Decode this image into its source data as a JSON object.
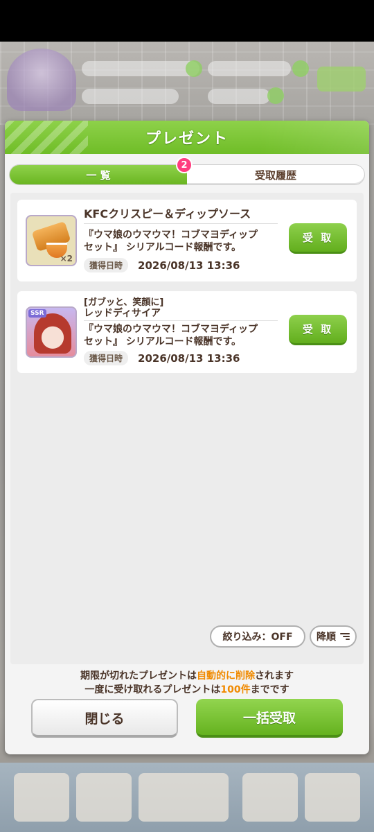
{
  "dialog": {
    "title": "プレゼント"
  },
  "tabs": [
    {
      "label": "一 覧",
      "active": true
    },
    {
      "label": "受取履歴",
      "active": false
    }
  ],
  "badge_count": "2",
  "presents": [
    {
      "title": "KFCクリスピー＆ディップソース",
      "desc1": "『ウマ娘のウマウマ！コブマヨディップ",
      "desc2": "セット』 シリアルコード報酬です。",
      "date_label": "獲得日時",
      "date_value": "2026/08/13 13:36",
      "button": "受 取",
      "qty": "×2",
      "icon": "food-item-icon"
    },
    {
      "title_line1": "[ガブッと、笑顔に]",
      "title_line2": "レッドディサイア",
      "desc1": "『ウマ娘のウマウマ！コブマヨディップ",
      "desc2": "セット』 シリアルコード報酬です。",
      "date_label": "獲得日時",
      "date_value": "2026/08/13 13:36",
      "button": "受 取",
      "rarity": "SSR",
      "icon": "support-card-icon"
    }
  ],
  "filter": {
    "label": "絞り込み：OFF"
  },
  "sort": {
    "label": "降順"
  },
  "notice": {
    "line1_pre": "期限が切れたプレゼントは",
    "line1_hl": "自動的に削除",
    "line1_post": "されます",
    "line2_pre": "一度に受け取れるプレゼントは",
    "line2_hl": "100件",
    "line2_post": "までです"
  },
  "buttons": {
    "close": "閉じる",
    "bulk": "一括受取"
  },
  "colors": {
    "accent_green": "#6fbd27",
    "badge_pink": "#ff3d7f",
    "highlight_orange": "#f08a00",
    "text_brown": "#4a3428"
  }
}
